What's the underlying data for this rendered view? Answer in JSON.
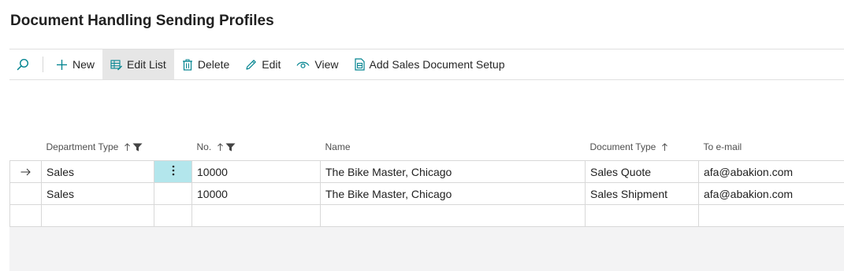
{
  "page": {
    "title": "Document Handling Sending Profiles"
  },
  "toolbar": {
    "new_label": "New",
    "edit_list_label": "Edit List",
    "delete_label": "Delete",
    "edit_label": "Edit",
    "view_label": "View",
    "add_setup_label": "Add Sales Document Setup"
  },
  "columns": {
    "department_type": "Department Type",
    "no": "No.",
    "name": "Name",
    "document_type": "Document Type",
    "to_email": "To e-mail"
  },
  "rows": [
    {
      "department_type": "Sales",
      "no": "10000",
      "name": "The Bike Master, Chicago",
      "document_type": "Sales Quote",
      "to_email": "afa@abakion.com"
    },
    {
      "department_type": "Sales",
      "no": "10000",
      "name": "The Bike Master, Chicago",
      "document_type": "Sales Shipment",
      "to_email": "afa@abakion.com"
    }
  ],
  "colors": {
    "accent": "#00838f",
    "selected_cell": "#b3e6ec"
  }
}
